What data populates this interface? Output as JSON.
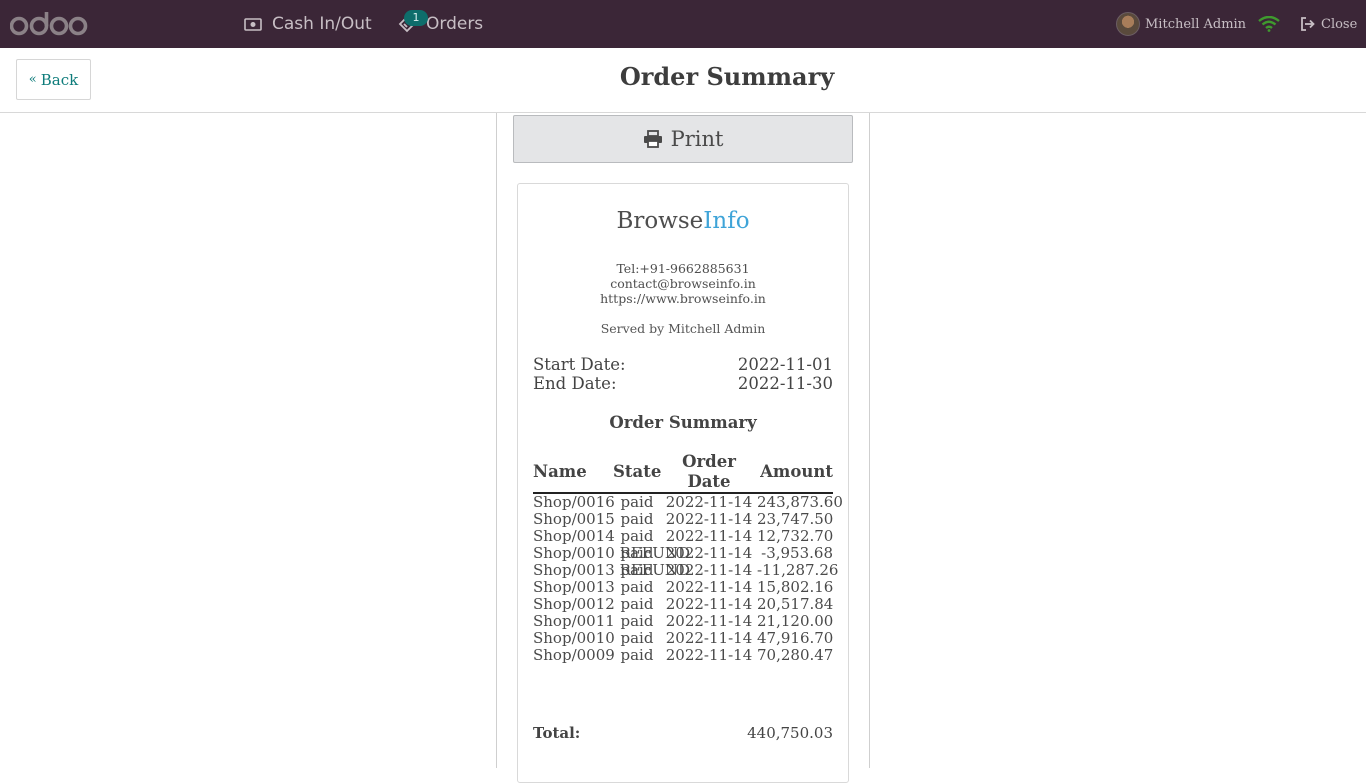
{
  "navbar": {
    "cash_label": "Cash In/Out",
    "orders_label": "Orders",
    "orders_badge": "1",
    "user_name": "Mitchell Admin",
    "close_label": "Close"
  },
  "header": {
    "back_label": "Back",
    "title": "Order Summary"
  },
  "print_label": "Print",
  "receipt": {
    "brand_main": "Browse",
    "brand_accent": "Info",
    "tel": "Tel:+91-9662885631",
    "email": "contact@browseinfo.in",
    "website": "https://www.browseinfo.in",
    "served_by": "Served by Mitchell Admin",
    "start_label": "Start Date:",
    "start_value": "2022-11-01",
    "end_label": "End Date:",
    "end_value": "2022-11-30",
    "summary_title": "Order Summary",
    "columns": [
      "Name",
      "State",
      "Order Date",
      "Amount"
    ],
    "rows": [
      {
        "name": "Shop/0016",
        "state": "paid",
        "date": "2022-11-14",
        "amount": "243,873.60"
      },
      {
        "name": "Shop/0015",
        "state": "paid",
        "date": "2022-11-14",
        "amount": "23,747.50"
      },
      {
        "name": "Shop/0014",
        "state": "paid",
        "date": "2022-11-14",
        "amount": "12,732.70"
      },
      {
        "name": "Shop/0010 REFUND",
        "state": "paid",
        "date": "2022-11-14",
        "amount": "-3,953.68"
      },
      {
        "name": "Shop/0013 REFUND",
        "state": "paid",
        "date": "2022-11-14",
        "amount": "-11,287.26"
      },
      {
        "name": "Shop/0013",
        "state": "paid",
        "date": "2022-11-14",
        "amount": "15,802.16"
      },
      {
        "name": "Shop/0012",
        "state": "paid",
        "date": "2022-11-14",
        "amount": "20,517.84"
      },
      {
        "name": "Shop/0011",
        "state": "paid",
        "date": "2022-11-14",
        "amount": "21,120.00"
      },
      {
        "name": "Shop/0010",
        "state": "paid",
        "date": "2022-11-14",
        "amount": "47,916.70"
      },
      {
        "name": "Shop/0009",
        "state": "paid",
        "date": "2022-11-14",
        "amount": "70,280.47"
      }
    ],
    "total_label": "Total:",
    "total_value": "440,750.03"
  },
  "colors": {
    "navbar_bg": "#3b2637",
    "accent_teal": "#0e7c7b",
    "brand_blue": "#3fa4d8",
    "wifi_green": "#3f9a2e"
  },
  "icons": [
    "odoo-logo",
    "money-icon",
    "ticket-icon",
    "avatar",
    "wifi-icon",
    "sign-out-icon",
    "angle-double-left-icon",
    "print-icon"
  ]
}
